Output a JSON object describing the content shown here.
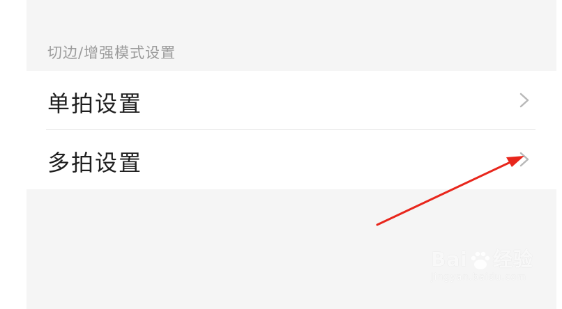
{
  "section_header": "切边/增强模式设置",
  "rows": [
    {
      "label": "单拍设置",
      "icon": "chevron-right-icon"
    },
    {
      "label": "多拍设置",
      "icon": "chevron-right-icon"
    }
  ],
  "watermark": {
    "brand_left": "Bai",
    "brand_right": "经验",
    "url": "jingyan.baidu.com"
  },
  "colors": {
    "background": "#f5f5f5",
    "row_background": "#ffffff",
    "annotation_arrow": "#e8261c"
  }
}
